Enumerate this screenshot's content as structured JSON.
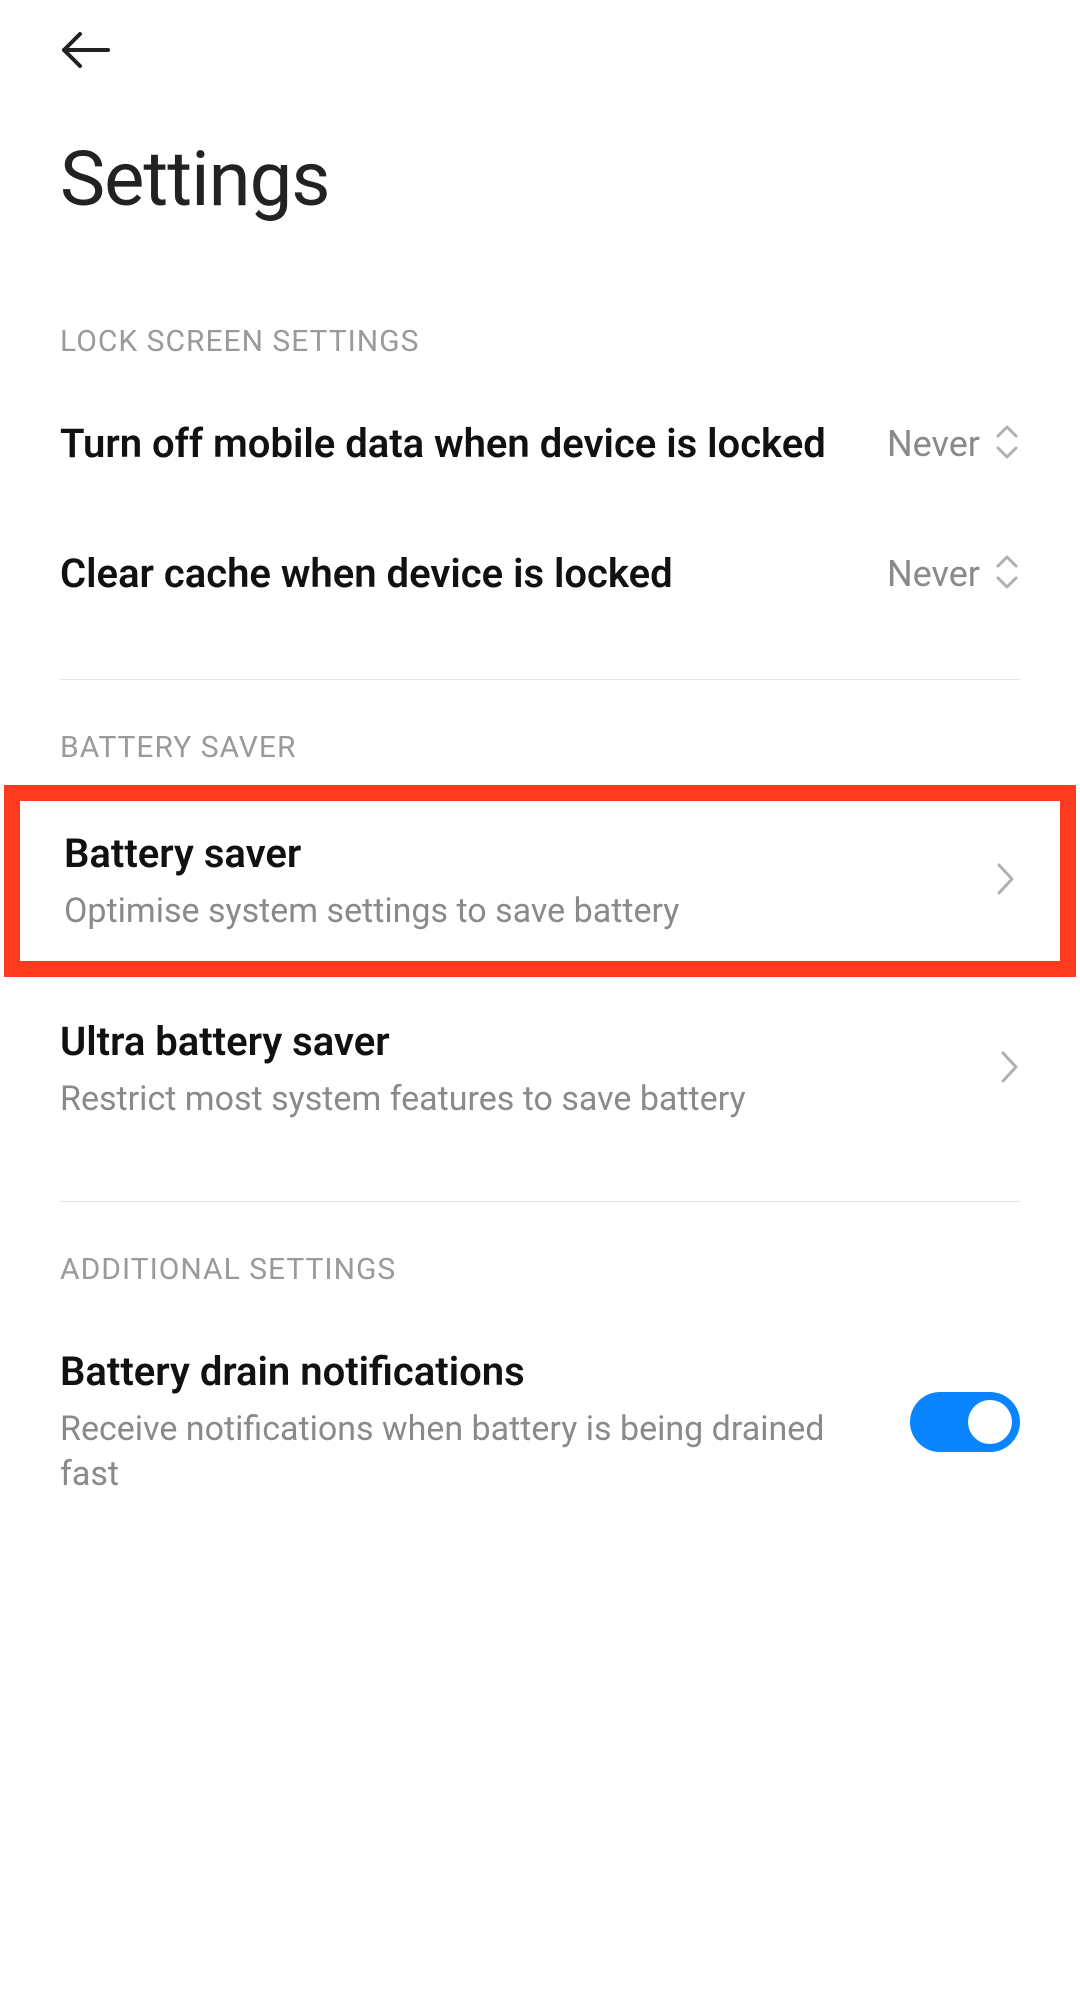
{
  "page": {
    "title": "Settings"
  },
  "sections": {
    "lock_screen": {
      "header": "LOCK SCREEN SETTINGS",
      "items": [
        {
          "title": "Turn off mobile data when device is locked",
          "value": "Never"
        },
        {
          "title": "Clear cache when device is locked",
          "value": "Never"
        }
      ]
    },
    "battery_saver": {
      "header": "BATTERY SAVER",
      "items": [
        {
          "title": "Battery saver",
          "sub": "Optimise system settings to save battery",
          "highlighted": true
        },
        {
          "title": "Ultra battery saver",
          "sub": "Restrict most system features to save battery"
        }
      ]
    },
    "additional": {
      "header": "ADDITIONAL SETTINGS",
      "items": [
        {
          "title": "Battery drain notifications",
          "sub": "Receive notifications when battery is being drained fast",
          "toggle": true
        }
      ]
    }
  }
}
